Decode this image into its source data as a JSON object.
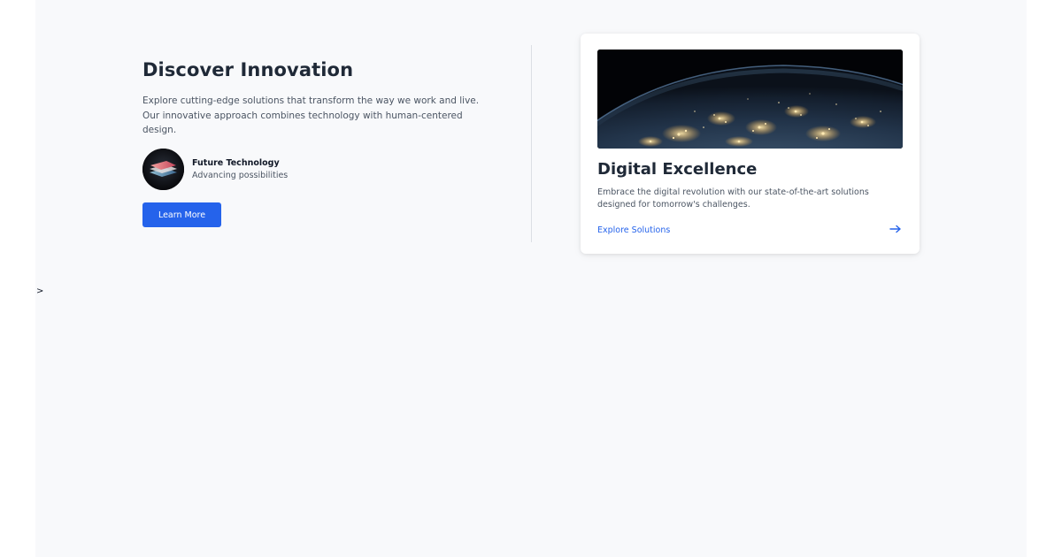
{
  "hero": {
    "title": "Discover Innovation",
    "description": "Explore cutting-edge solutions that transform the way we work and live. Our innovative approach combines technology with human-centered design.",
    "author": {
      "name": "Future Technology",
      "tagline": "Advancing possibilities",
      "avatar_icon": "abstract-layers-avatar"
    },
    "cta_label": "Learn More"
  },
  "card": {
    "image_icon": "earth-night-lights-image",
    "title": "Digital Excellence",
    "description": "Embrace the digital revolution with our state-of-the-art solutions designed for tomorrow's challenges.",
    "link_label": "Explore Solutions",
    "arrow_icon": "arrow-right-icon"
  },
  "stray_text": ">",
  "colors": {
    "accent": "#2563eb",
    "heading": "#1f2937",
    "body": "#4b5563",
    "page_background": "#f8f9fb"
  }
}
